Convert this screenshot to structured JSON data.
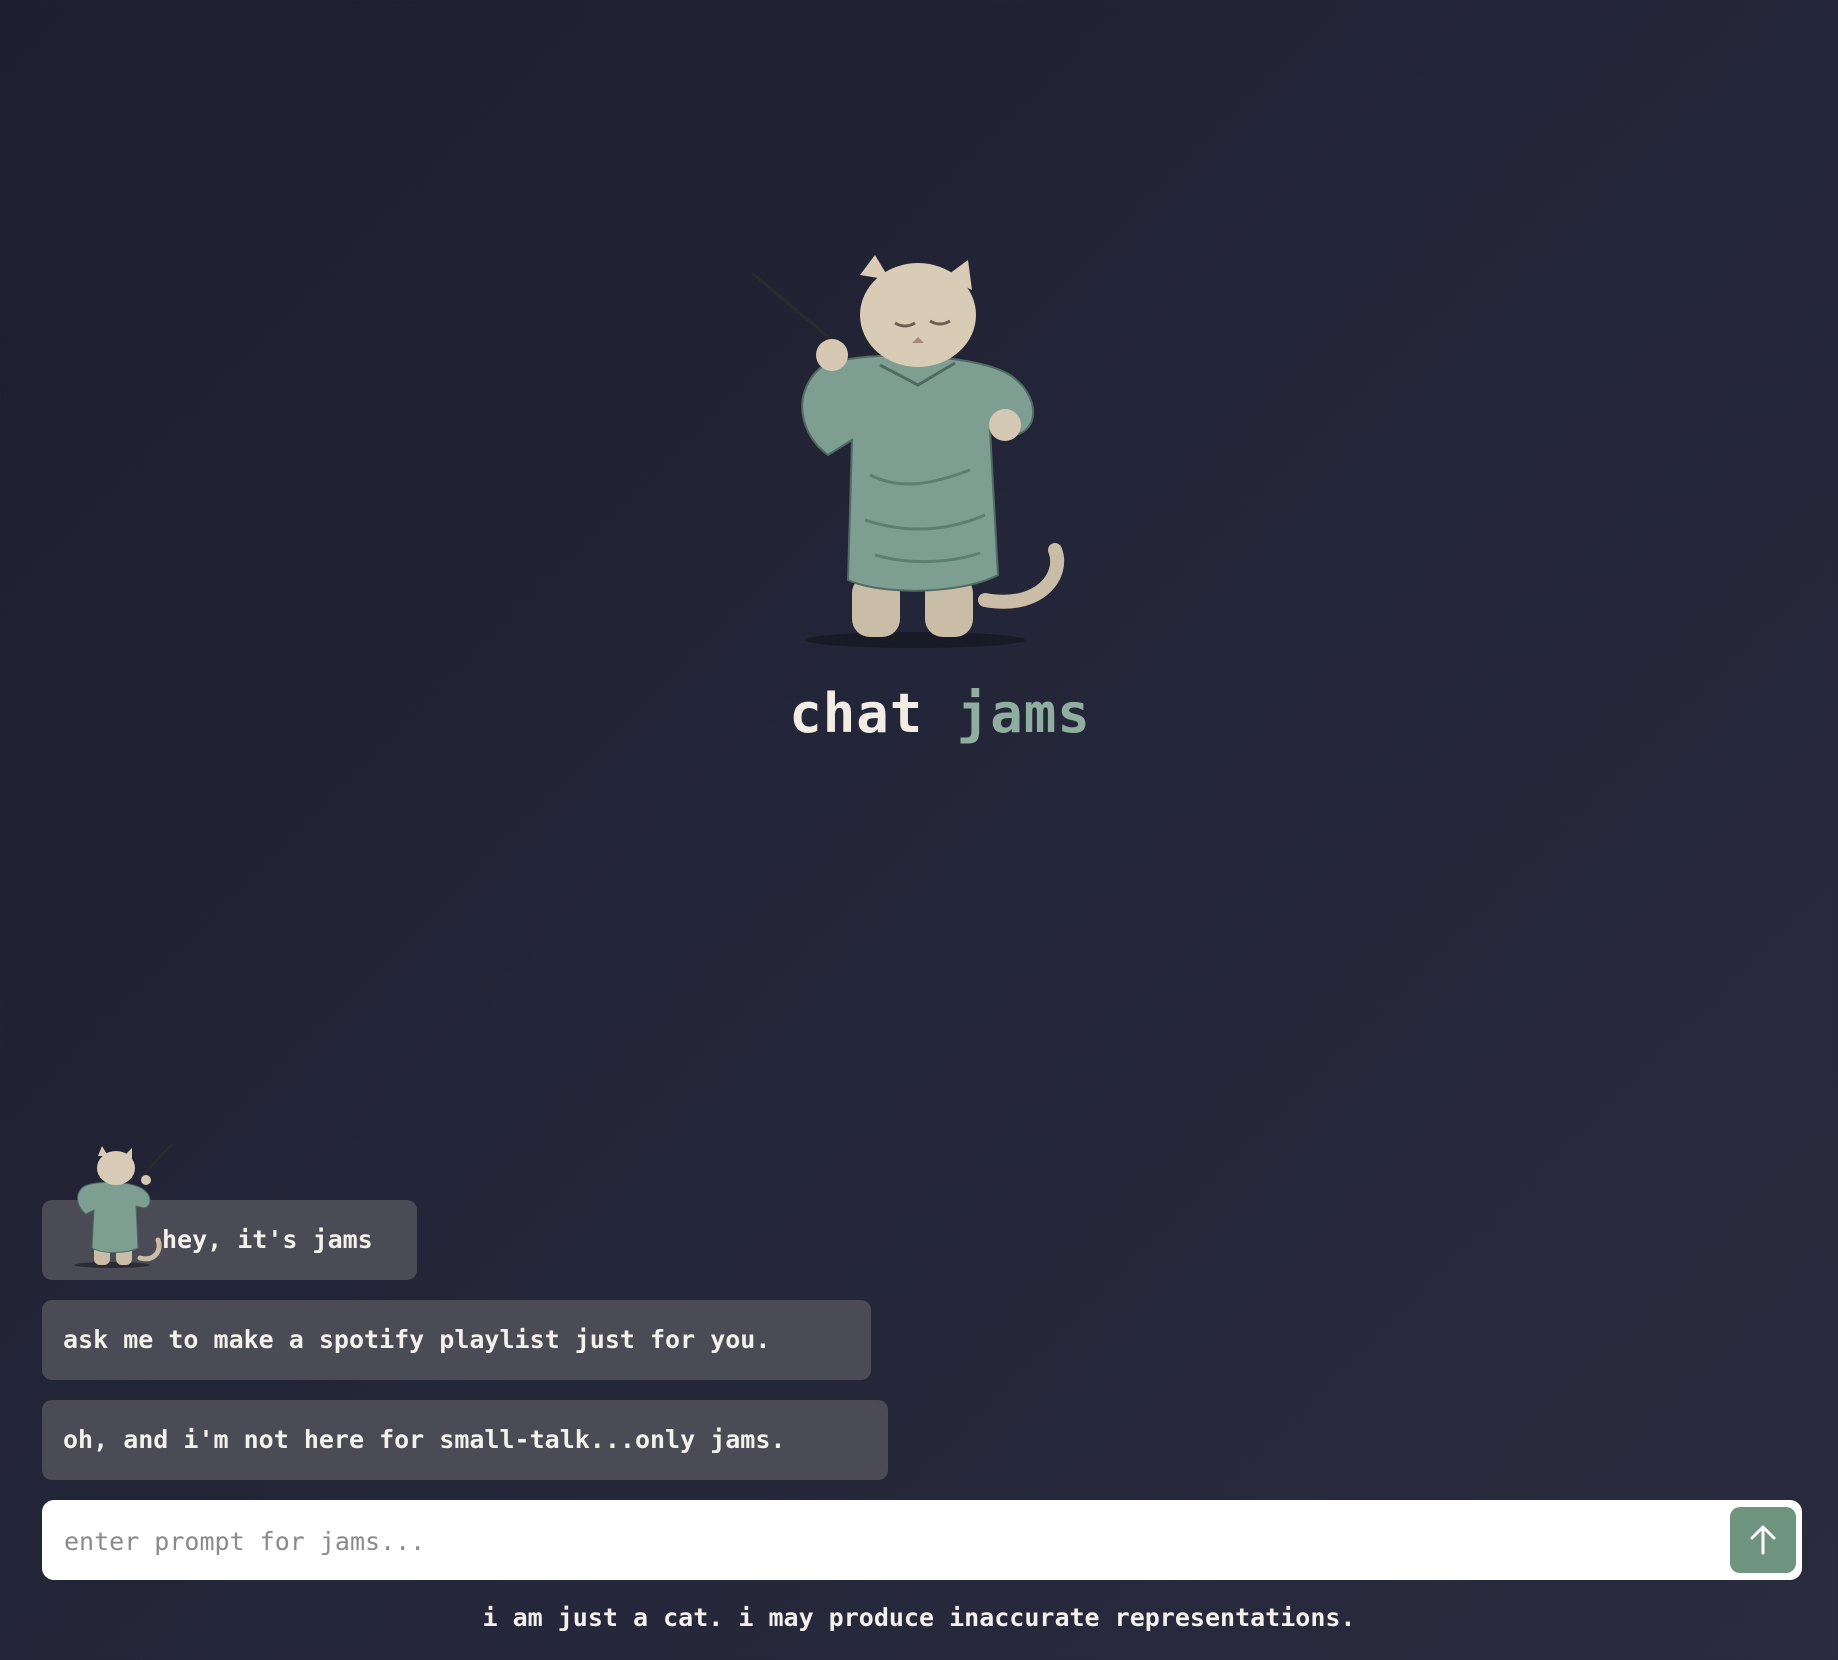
{
  "hero": {
    "title_part1": "chat",
    "title_part2": "jams"
  },
  "chat": {
    "messages": [
      {
        "text": "hey, it's jams"
      },
      {
        "text": "ask me to make a spotify playlist just for you."
      },
      {
        "text": "oh, and i'm not here for small-talk...only jams."
      }
    ]
  },
  "input": {
    "placeholder": "enter prompt for jams...",
    "value": ""
  },
  "footer": {
    "disclaimer": "i am just a cat. i may produce inaccurate representations."
  },
  "icons": {
    "send": "arrow-up-icon",
    "mascot": "cat-conductor-icon"
  },
  "colors": {
    "accent": "#8fae9f",
    "send_button": "#6e937f",
    "bubble": "#4b4b55",
    "background": "#232538"
  }
}
